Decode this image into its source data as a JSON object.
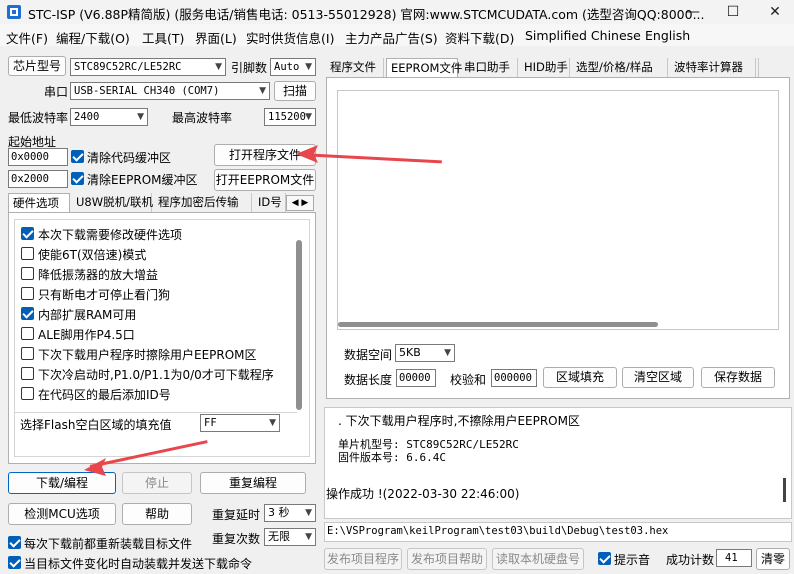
{
  "window": {
    "title": "STC-ISP (V6.88P精简版) (服务电话/销售电话: 0513-55012928) 官网:www.STCMCUDATA.com  (选型咨询QQ:8000...",
    "min_glyph": "—",
    "max_glyph": "☐",
    "close_glyph": "✕"
  },
  "menu": [
    "文件(F)",
    "编程/下载(O)",
    "工具(T)",
    "界面(L)",
    "实时供货信息(I)",
    "主力产品广告(S)",
    "资料下载(D)",
    "Simplified Chinese",
    "English"
  ],
  "chip": {
    "label": "芯片型号",
    "value": "STC89C52RC/LE52RC",
    "pin_label": "引脚数",
    "pin_value": "Auto"
  },
  "port": {
    "label": "串口",
    "value": "USB-SERIAL CH340 (COM7)",
    "scan_button": "扫描"
  },
  "baud": {
    "min_label": "最低波特率",
    "min_value": "2400",
    "max_label": "最高波特率",
    "max_value": "115200"
  },
  "address": {
    "label": "起始地址",
    "code_addr": "0x0000",
    "code_clear": "清除代码缓冲区",
    "open_program": "打开程序文件",
    "eeprom_addr": "0x2000",
    "eeprom_clear": "清除EEPROM缓冲区",
    "open_eeprom": "打开EEPROM文件"
  },
  "left_tabs": [
    "硬件选项",
    "U8W脱机/联机",
    "程序加密后传输",
    "ID号"
  ],
  "hw_options": [
    {
      "label": "本次下载需要修改硬件选项",
      "checked": true
    },
    {
      "label": "使能6T(双倍速)模式",
      "checked": false
    },
    {
      "label": "降低振荡器的放大增益",
      "checked": false
    },
    {
      "label": "只有断电才可停止看门狗",
      "checked": false
    },
    {
      "label": "内部扩展RAM可用",
      "checked": true
    },
    {
      "label": "ALE脚用作P4.5口",
      "checked": false
    },
    {
      "label": "下次下载用户程序时擦除用户EEPROM区",
      "checked": false
    },
    {
      "label": "下次冷启动时,P1.0/P1.1为0/0才可下载程序",
      "checked": false
    },
    {
      "label": "在代码区的最后添加ID号",
      "checked": false
    }
  ],
  "flash_fill": {
    "label": "选择Flash空白区域的填充值",
    "value": "FF"
  },
  "buttons": {
    "download": "下载/编程",
    "stop": "停止",
    "reprogram": "重复编程",
    "detect": "检测MCU选项",
    "help": "帮助"
  },
  "repeat": {
    "delay_label": "重复延时",
    "delay_value": "3 秒",
    "count_label": "重复次数",
    "count_value": "无限"
  },
  "bottom_checks": [
    {
      "label": "每次下载前都重新装载目标文件",
      "checked": true
    },
    {
      "label": "当目标文件变化时自动装载并发送下载命令",
      "checked": true
    }
  ],
  "right_tabs": [
    "程序文件",
    "EEPROM文件",
    "串口助手",
    "HID助手",
    "选型/价格/样品",
    "波特率计算器"
  ],
  "eeprom": {
    "space_label": "数据空间",
    "space_value": "5KB",
    "length_label": "数据长度",
    "length_value": "00000",
    "checksum_label": "校验和",
    "checksum_value": "000000",
    "fill_button": "区域填充",
    "clear_button": "清空区域",
    "save_button": "保存数据"
  },
  "log": {
    "line1": ". 下次下载用户程序时,不擦除用户EEPROM区",
    "line2": "单片机型号: STC89C52RC/LE52RC",
    "line3": "固件版本号: 6.6.4C",
    "line4": "操作成功 !(2022-03-30 22:46:00)"
  },
  "path": "E:\\VSProgram\\keilProgram\\test03\\build\\Debug\\test03.hex",
  "footer": {
    "publish_program": "发布项目程序",
    "publish_help": "发布项目帮助",
    "read_disk": "读取本机硬盘号",
    "sound_label": "提示音",
    "sound_checked": true,
    "success_label": "成功计数",
    "success_value": "41",
    "clear_button": "清零"
  },
  "colors": {
    "accent": "#005fb8",
    "arrow": "#e8464d"
  }
}
